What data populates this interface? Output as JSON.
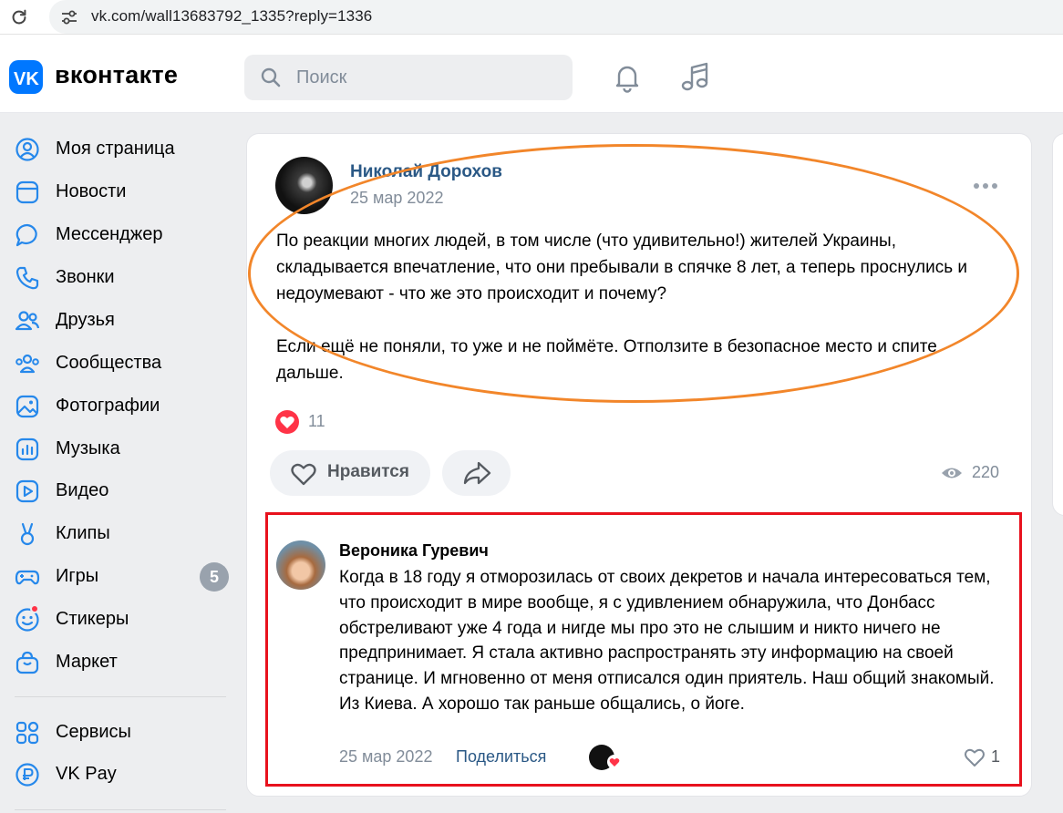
{
  "browser": {
    "url": "vk.com/wall13683792_1335?reply=1336"
  },
  "header": {
    "logo_text": "вконтакте",
    "search_placeholder": "Поиск",
    "icons": [
      "bell-icon",
      "music-icon"
    ]
  },
  "sidebar": {
    "items": [
      {
        "label": "Моя страница",
        "icon": "profile-icon"
      },
      {
        "label": "Новости",
        "icon": "news-icon"
      },
      {
        "label": "Мессенджер",
        "icon": "messenger-icon"
      },
      {
        "label": "Звонки",
        "icon": "phone-icon"
      },
      {
        "label": "Друзья",
        "icon": "friends-icon"
      },
      {
        "label": "Сообщества",
        "icon": "communities-icon"
      },
      {
        "label": "Фотографии",
        "icon": "photos-icon"
      },
      {
        "label": "Музыка",
        "icon": "music-chart-icon"
      },
      {
        "label": "Видео",
        "icon": "video-icon"
      },
      {
        "label": "Клипы",
        "icon": "clips-icon"
      },
      {
        "label": "Игры",
        "icon": "gamepad-icon",
        "badge": "5"
      },
      {
        "label": "Стикеры",
        "icon": "smile-icon"
      },
      {
        "label": "Маркет",
        "icon": "bag-icon"
      }
    ],
    "secondary": [
      {
        "label": "Сервисы",
        "icon": "services-icon"
      },
      {
        "label": "VK Pay",
        "icon": "vkpay-icon"
      }
    ]
  },
  "post": {
    "author": "Николай Дорохов",
    "date": "25 мар 2022",
    "text": "По реакции многих людей, в том числе (что удивительно!) жителей Украины, складывается впечатление, что они пребывали в спячке 8 лет, а теперь проснулись и недоумевают - что же это происходит и почему?\n\nЕсли ещё не поняли, то уже и не поймёте. Отползите в безопасное место и спите дальше.",
    "reactions_count": "11",
    "like_label": "Нравится",
    "views": "220"
  },
  "comment": {
    "author": "Вероника Гуревич",
    "text": "Когда в 18 году я отморозилась от своих декретов и начала интересоваться тем, что происходит в мире вообще, я с удивлением обнаружила, что Донбасс обстреливают уже 4 года и нигде мы про это не слышим и никто ничего не предпринимает. Я стала активно распространять эту информацию на своей странице. И мгновенно от меня отписался один приятель. Наш общий знакомый. Из Киева. А хорошо так раньше общались, о йоге.",
    "date": "25 мар 2022",
    "share_label": "Поделиться",
    "likes": "1"
  },
  "colors": {
    "accent": "#0077ff",
    "link": "#2a5885",
    "highlight_orange": "#f2862a",
    "highlight_red": "#e8111d",
    "heart": "#ff3347"
  }
}
